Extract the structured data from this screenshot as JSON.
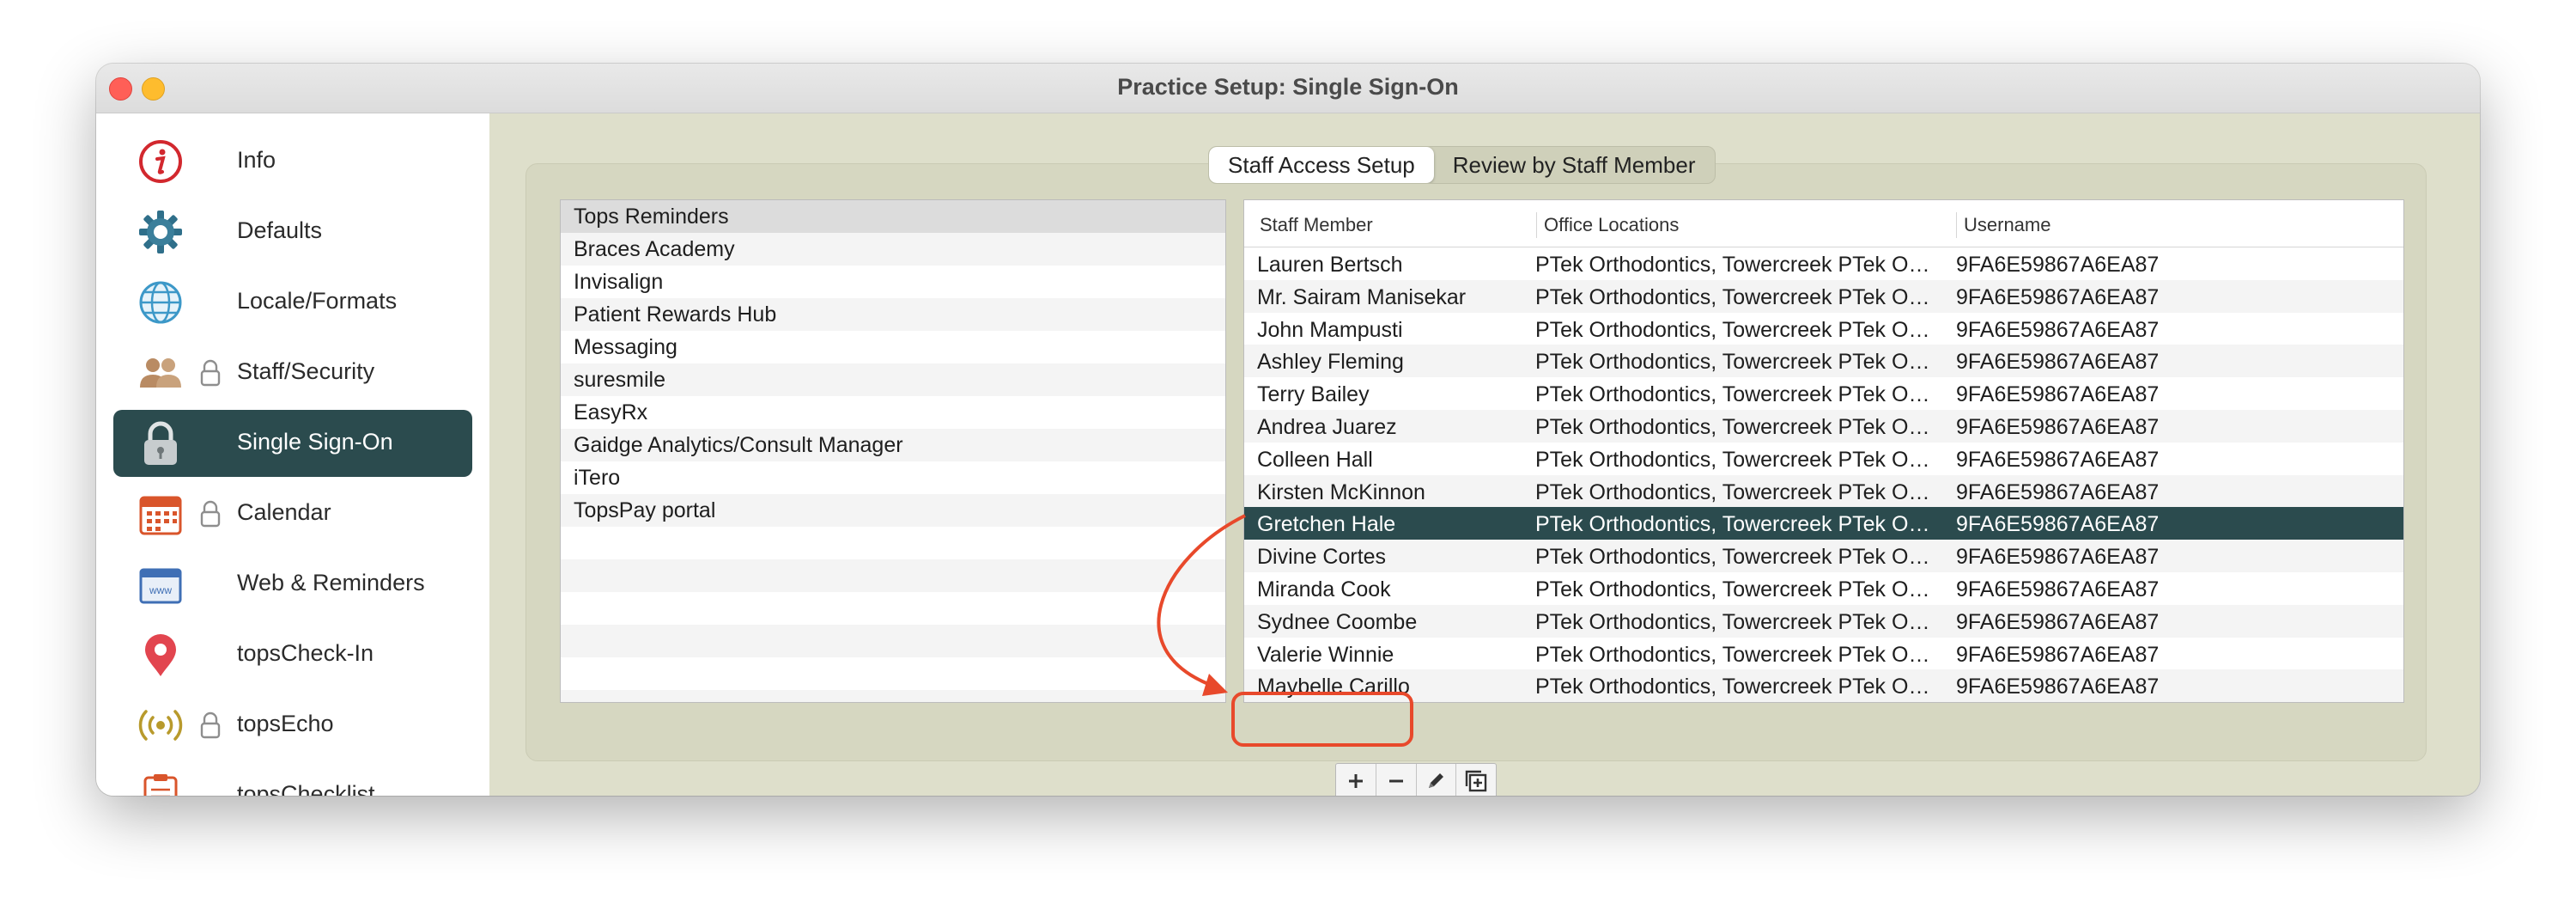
{
  "window": {
    "title": "Practice Setup: Single Sign-On"
  },
  "sidebar": {
    "items": [
      {
        "label": "Info",
        "icon": "info-icon"
      },
      {
        "label": "Defaults",
        "icon": "gear-icon"
      },
      {
        "label": "Locale/Formats",
        "icon": "globe-icon"
      },
      {
        "label": "Staff/Security",
        "icon": "staff-icon",
        "locked": true
      },
      {
        "label": "Single Sign-On",
        "icon": "padlock-icon",
        "active": true
      },
      {
        "label": "Calendar",
        "icon": "calendar-icon",
        "locked": true
      },
      {
        "label": "Web & Reminders",
        "icon": "web-icon"
      },
      {
        "label": "topsCheck-In",
        "icon": "map-pin-icon"
      },
      {
        "label": "topsEcho",
        "icon": "broadcast-icon",
        "locked": true
      },
      {
        "label": "topsChecklist",
        "icon": "clipboard-icon"
      }
    ]
  },
  "tabs": [
    {
      "label": "Staff Access Setup",
      "active": true
    },
    {
      "label": "Review by Staff Member",
      "active": false
    }
  ],
  "services": {
    "items": [
      "Tops Reminders",
      "Braces Academy",
      "Invisalign",
      "Patient Rewards Hub",
      "Messaging",
      "suresmile",
      "EasyRx",
      "Gaidge Analytics/Consult Manager",
      "iTero",
      "TopsPay portal"
    ],
    "selected_index": 0
  },
  "staff_table": {
    "columns": [
      "Staff Member",
      "Office Locations",
      "Username"
    ],
    "rows": [
      [
        "Lauren Bertsch",
        "PTek Orthodontics, Towercreek PTek Orthodontics",
        "9FA6E59867A6EA87"
      ],
      [
        "Mr. Sairam Manisekar",
        "PTek Orthodontics, Towercreek PTek Orthodontics",
        "9FA6E59867A6EA87"
      ],
      [
        "John Mampusti",
        "PTek Orthodontics, Towercreek PTek Orthodontics",
        "9FA6E59867A6EA87"
      ],
      [
        "Ashley Fleming",
        "PTek Orthodontics, Towercreek PTek Orthodontics",
        "9FA6E59867A6EA87"
      ],
      [
        "Terry Bailey",
        "PTek Orthodontics, Towercreek PTek Orthodontics",
        "9FA6E59867A6EA87"
      ],
      [
        "Andrea Juarez",
        "PTek Orthodontics, Towercreek PTek Orthodontics",
        "9FA6E59867A6EA87"
      ],
      [
        "Colleen Hall",
        "PTek Orthodontics, Towercreek PTek Orthodontics",
        "9FA6E59867A6EA87"
      ],
      [
        "Kirsten McKinnon",
        "PTek Orthodontics, Towercreek PTek Orthodontics",
        "9FA6E59867A6EA87"
      ],
      [
        "Gretchen Hale",
        "PTek Orthodontics, Towercreek PTek Orthodontics",
        "9FA6E59867A6EA87"
      ],
      [
        "Divine Cortes",
        "PTek Orthodontics, Towercreek PTek Orthodontics",
        "9FA6E59867A6EA87"
      ],
      [
        "Miranda Cook",
        "PTek Orthodontics, Towercreek PTek Orthodontics",
        "9FA6E59867A6EA87"
      ],
      [
        "Sydnee Coombe",
        "PTek Orthodontics, Towercreek PTek Orthodontics",
        "9FA6E59867A6EA87"
      ],
      [
        "Valerie Winnie",
        "PTek Orthodontics, Towercreek PTek Orthodontics",
        "9FA6E59867A6EA87"
      ],
      [
        "Maybelle Carillo",
        "PTek Orthodontics, Towercreek PTek Orthodontics",
        "9FA6E59867A6EA87"
      ]
    ],
    "selected_index": 8
  },
  "toolbar": {
    "add_icon": "plus-icon",
    "remove_icon": "minus-icon",
    "edit_icon": "pencil-icon",
    "add_multiple_icon": "add-multiple-icon"
  },
  "colors": {
    "selection": "#2b4b4e",
    "annotation": "#e8492b",
    "panel_background": "#dedfcb"
  }
}
